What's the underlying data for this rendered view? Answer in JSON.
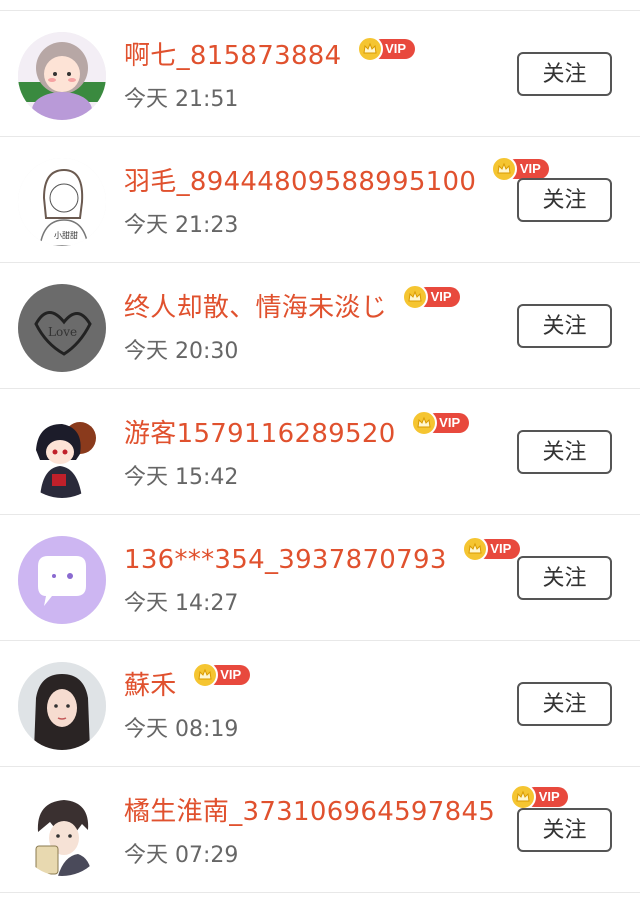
{
  "users": [
    {
      "name": "啊七_815873884",
      "vip": "VIP",
      "time": "今天 21:51",
      "follow": "关注",
      "avatar": "avatar-girl-purple"
    },
    {
      "name": "羽毛_89444809588995100",
      "vip": "VIP",
      "time": "今天 21:23",
      "follow": "关注",
      "avatar": "avatar-sketch-girl"
    },
    {
      "name": "终人却散、情海未淡じ",
      "vip": "VIP",
      "time": "今天 20:30",
      "follow": "关注",
      "avatar": "avatar-heart-gray"
    },
    {
      "name": "游客1579116289520",
      "vip": "VIP",
      "time": "今天 15:42",
      "follow": "关注",
      "avatar": "avatar-anime-ninja"
    },
    {
      "name": "136***354_3937870793",
      "vip": "VIP",
      "time": "今天 14:27",
      "follow": "关注",
      "avatar": "avatar-chat-bubble"
    },
    {
      "name": "蘇禾",
      "vip": "VIP",
      "time": "今天 08:19",
      "follow": "关注",
      "avatar": "avatar-photo-girl"
    },
    {
      "name": "橘生淮南_373106964597845",
      "vip": "VIP",
      "time": "今天 07:29",
      "follow": "关注",
      "avatar": "avatar-anime-boy"
    }
  ],
  "colors": {
    "name": "#e0512e",
    "vip_badge": "#e8493d",
    "crown": "#f5c531",
    "time": "#666666"
  }
}
